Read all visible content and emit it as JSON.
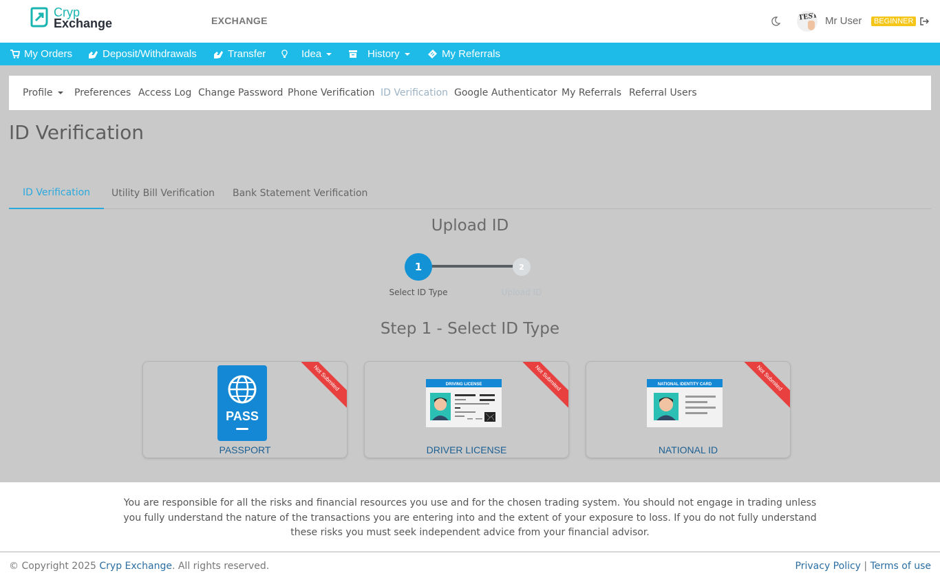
{
  "header": {
    "logo_line1": "Cryp",
    "logo_line2": "Exchange",
    "section_label": "EXCHANGE",
    "avatar_text": "TEST",
    "username": "Mr User",
    "level_badge": "BEGINNER"
  },
  "navbar": {
    "items": [
      {
        "label": "My Orders",
        "icon": "cart-icon"
      },
      {
        "label": "Deposit/Withdrawals",
        "icon": "hands-icon"
      },
      {
        "label": "Transfer",
        "icon": "hands-icon"
      },
      {
        "label": "Idea",
        "icon": "lightbulb-icon"
      },
      {
        "label": "History",
        "icon": "archive-icon"
      },
      {
        "label": "My Referrals",
        "icon": "ticket-icon"
      }
    ]
  },
  "subnav": {
    "items": [
      "Profile",
      "Preferences",
      "Access Log",
      "Change Password",
      "Phone Verification",
      "ID Verification",
      "Google Authenticator",
      "My Referrals",
      "Referral Users"
    ],
    "active": "ID Verification"
  },
  "page": {
    "title": "ID Verification",
    "tabs": [
      "ID Verification",
      "Utility Bill Verification",
      "Bank Statement Verification"
    ],
    "active_tab": "ID Verification",
    "upload_title": "Upload ID",
    "steps": [
      {
        "number": "1",
        "label": "Select ID Type"
      },
      {
        "number": "2",
        "label": "Upload ID"
      }
    ],
    "step_heading": "Step 1 - Select ID Type"
  },
  "id_cards": [
    {
      "label": "PASSPORT",
      "status": "Not Submited",
      "image_text": "PASS"
    },
    {
      "label": "DRIVER LICENSE",
      "status": "Not Submited",
      "image_text": "DRIVING LICENSE"
    },
    {
      "label": "NATIONAL ID",
      "status": "Not Submited",
      "image_text": "NATIONAL IDENTITY CARD"
    }
  ],
  "disclaimer": "You are responsible for all the risks and financial resources you use and for the chosen trading system. You should not engage in trading unless you fully understand the nature of the transactions you are entering into and the extent of your exposure to loss. If you do not fully understand these risks you must seek independent advice from your financial advisor.",
  "footer": {
    "copyright_prefix": "© Copyright 2025 ",
    "brand": "Cryp Exchange",
    "copyright_suffix": ". All rights reserved.",
    "privacy": "Privacy Policy",
    "separator": "|",
    "terms": "Terms of use"
  },
  "colors": {
    "nav_bar": "#1ebbe9",
    "step_active": "#1393d5",
    "ribbon": "#e8403f",
    "badge": "#f5c518",
    "link": "#2a6ea3"
  }
}
